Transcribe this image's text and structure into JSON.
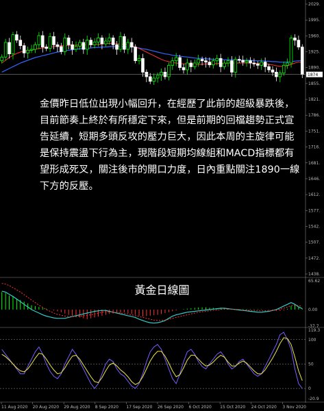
{
  "overlay_text": "金價昨日低位出現小幅回升，在經歷了此前的超級暴跌後，目前節奏上終於有所穩定下來，但是前期的回檔趨勢正式宣告延續，短期多頭反攻的壓力巨大，因此本周的主旋律可能是保持震盪下行為主，現階段短期均線組和MACD指標都有望形成死叉，關注後市的開口力度，日內重點關注1890一線下方的反壓。",
  "panel_title": "黃金日線圖",
  "current_price_label": "1874",
  "colors": {
    "bull": "#00ff00",
    "bear": "#ffffff",
    "ma_red": "#ff3333",
    "ma_blue": "#3366ff",
    "ma_yellow": "#f0e64a",
    "ma_white": "#ffffff",
    "purple": "#7a5cff",
    "teal": "#33cccc"
  },
  "chart_data": {
    "type": "candlestick",
    "x_ticks": [
      "11 Aug 2020",
      "20 Aug 2020",
      "29 Aug 2020",
      "8 Sep 2020",
      "17 Sep 2020",
      "26 Sep 2020",
      "6 Oct 2020",
      "15 Oct 2020",
      "24 Oct 2020",
      "3 Nov 2020"
    ],
    "price_axis_ticks": [
      "2029.",
      "1995.",
      "1960.",
      "1925.",
      "1890.",
      "1855.",
      "1821.",
      "1786.",
      "1751.",
      "1716.",
      "1681.",
      "1646.",
      "1612.",
      "1577.",
      "1542.",
      "1507.",
      "1472.",
      "1438."
    ],
    "price_range": [
      1438,
      2029
    ],
    "closes": [
      1913,
      1945,
      1920,
      1962,
      1950,
      1938,
      1922,
      1928,
      1930,
      1940,
      1960,
      1935,
      1932,
      1958,
      1940,
      1936,
      1925,
      1955,
      1940,
      1930,
      1937,
      1945,
      1930,
      1950,
      1940,
      1946,
      1955,
      1942,
      1948,
      1955,
      1940,
      1930,
      1958,
      1930,
      1945,
      1935,
      1905,
      1910,
      1880,
      1870,
      1860,
      1867,
      1873,
      1880,
      1870,
      1895,
      1905,
      1912,
      1890,
      1885,
      1900,
      1892,
      1900,
      1908,
      1905,
      1902,
      1896,
      1905,
      1910,
      1892,
      1900,
      1905,
      1880,
      1908,
      1906,
      1902,
      1905,
      1900,
      1898,
      1895,
      1902,
      1892,
      1885,
      1880,
      1870,
      1878,
      1895,
      1900,
      1955,
      1950,
      1935,
      1875
    ],
    "ma_red": [
      1900,
      1906,
      1912,
      1917,
      1921,
      1924,
      1926,
      1927,
      1928,
      1930,
      1932,
      1933,
      1934,
      1935,
      1936,
      1937,
      1938,
      1938,
      1939,
      1939,
      1939,
      1940,
      1940,
      1940,
      1941,
      1941,
      1941,
      1942,
      1942,
      1943,
      1943,
      1942,
      1942,
      1941,
      1940,
      1938,
      1935,
      1932,
      1928,
      1924,
      1920,
      1916,
      1912,
      1908,
      1905,
      1903,
      1901,
      1900,
      1899,
      1898,
      1898,
      1897,
      1897,
      1897,
      1897,
      1898,
      1898,
      1898,
      1899,
      1899,
      1899,
      1900,
      1900,
      1900,
      1900,
      1900,
      1900,
      1900,
      1900,
      1899,
      1899,
      1898,
      1897,
      1896,
      1894,
      1893,
      1893,
      1894,
      1897,
      1900,
      1902,
      1901
    ],
    "ma_blue": [
      1880,
      1884,
      1888,
      1892,
      1896,
      1900,
      1903,
      1906,
      1909,
      1912,
      1914,
      1916,
      1918,
      1920,
      1922,
      1924,
      1925,
      1927,
      1928,
      1929,
      1930,
      1931,
      1932,
      1932,
      1933,
      1934,
      1934,
      1935,
      1935,
      1936,
      1936,
      1936,
      1936,
      1936,
      1935,
      1935,
      1934,
      1933,
      1931,
      1930,
      1928,
      1926,
      1924,
      1922,
      1920,
      1919,
      1917,
      1916,
      1915,
      1914,
      1913,
      1912,
      1911,
      1910,
      1910,
      1909,
      1909,
      1908,
      1908,
      1908,
      1907,
      1907,
      1907,
      1907,
      1906,
      1906,
      1906,
      1906,
      1905,
      1905,
      1905,
      1904,
      1904,
      1903,
      1903,
      1902,
      1902,
      1902,
      1903,
      1904,
      1905,
      1905
    ],
    "macd_range": [
      -37.7,
      65.62
    ],
    "macd_ticks": [
      "65.62",
      "0.00",
      "-37.7"
    ],
    "macd_hist": [
      40,
      38,
      32,
      30,
      25,
      22,
      18,
      14,
      10,
      8,
      6,
      4,
      2,
      0,
      -2,
      -4,
      -6,
      -9,
      -12,
      -14,
      -16,
      -18,
      -20,
      -22,
      -20,
      -18,
      -16,
      -14,
      -12,
      -10,
      -9,
      -8,
      -7,
      -6,
      -8,
      -10,
      -12,
      -14,
      -16,
      -15,
      -14,
      -13,
      -12,
      -10,
      -8,
      -6,
      -4,
      -2,
      0,
      1,
      2,
      3,
      4,
      5,
      5,
      5,
      4,
      4,
      3,
      3,
      2,
      2,
      1,
      1,
      1,
      1,
      1,
      1,
      1,
      1,
      1,
      0,
      -1,
      -2,
      -3,
      -3,
      -2,
      2,
      8,
      10,
      6,
      2
    ],
    "macd_line": [
      42,
      40,
      35,
      30,
      24,
      18,
      12,
      6,
      0,
      -4,
      -8,
      -12,
      -15,
      -17,
      -19,
      -20,
      -20,
      -20,
      -18,
      -16,
      -14,
      -12,
      -10,
      -8,
      -6,
      -4,
      -3,
      -2,
      -2,
      -4,
      -6,
      -8,
      -10,
      -12,
      -14,
      -16,
      -18,
      -22,
      -25,
      -28,
      -30,
      -31,
      -30,
      -28,
      -25,
      -20,
      -15,
      -12,
      -10,
      -8,
      -6,
      -5,
      -4,
      -3,
      -2,
      -1,
      0,
      1,
      2,
      3,
      3,
      2,
      1,
      0,
      -1,
      -2,
      -3,
      -4,
      -5,
      -6,
      -6,
      -5,
      -4,
      -2,
      0,
      4,
      8,
      12,
      16,
      12,
      6,
      2
    ],
    "macd_signal": [
      60,
      58,
      55,
      50,
      45,
      40,
      34,
      28,
      22,
      16,
      10,
      5,
      0,
      -4,
      -8,
      -11,
      -13,
      -15,
      -16,
      -16,
      -16,
      -15,
      -14,
      -13,
      -12,
      -10,
      -8,
      -6,
      -5,
      -5,
      -6,
      -7,
      -8,
      -9,
      -10,
      -12,
      -14,
      -16,
      -18,
      -20,
      -22,
      -24,
      -25,
      -25,
      -24,
      -22,
      -20,
      -18,
      -16,
      -14,
      -12,
      -10,
      -8,
      -6,
      -5,
      -4,
      -3,
      -2,
      -1,
      0,
      1,
      1,
      1,
      0,
      0,
      -1,
      -1,
      -2,
      -2,
      -3,
      -3,
      -3,
      -3,
      -2,
      -1,
      1,
      3,
      6,
      9,
      10,
      9,
      7
    ],
    "osc_range": [
      -20.9,
      119.3
    ],
    "osc_ticks": [
      "119.3",
      "100",
      "50",
      "0",
      "-20.9"
    ],
    "osc_purple": [
      80,
      70,
      60,
      50,
      40,
      30,
      30,
      45,
      60,
      75,
      85,
      70,
      50,
      35,
      25,
      20,
      30,
      50,
      65,
      80,
      70,
      55,
      40,
      25,
      10,
      0,
      10,
      30,
      50,
      60,
      55,
      40,
      30,
      25,
      15,
      5,
      0,
      10,
      30,
      55,
      75,
      85,
      90,
      80,
      60,
      40,
      20,
      10,
      30,
      55,
      75,
      80,
      70,
      55,
      45,
      40,
      50,
      60,
      70,
      75,
      65,
      50,
      40,
      45,
      55,
      60,
      50,
      40,
      30,
      25,
      30,
      45,
      60,
      75,
      90,
      110,
      115,
      100,
      80,
      40,
      10,
      0
    ],
    "osc_yellow": [
      70,
      65,
      58,
      50,
      42,
      36,
      34,
      40,
      50,
      62,
      72,
      70,
      60,
      48,
      38,
      30,
      32,
      42,
      55,
      66,
      68,
      60,
      48,
      36,
      24,
      14,
      12,
      22,
      36,
      48,
      52,
      46,
      38,
      32,
      24,
      14,
      8,
      12,
      24,
      40,
      56,
      68,
      76,
      76,
      66,
      52,
      36,
      24,
      28,
      42,
      58,
      68,
      68,
      60,
      52,
      46,
      48,
      54,
      62,
      68,
      64,
      54,
      46,
      46,
      52,
      56,
      52,
      44,
      36,
      30,
      30,
      38,
      50,
      62,
      76,
      92,
      104,
      102,
      90,
      64,
      36,
      16
    ]
  }
}
